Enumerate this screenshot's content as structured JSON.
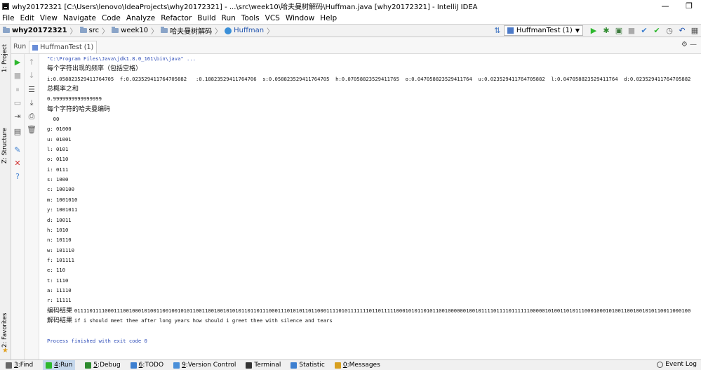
{
  "window": {
    "title": "why20172321 [C:\\Users\\lenovo\\IdeaProjects\\why20172321] - ...\\src\\week10\\哈夫曼树解码\\Huffman.java [why20172321] - IntelliJ IDEA",
    "minimize": "—",
    "maximize": "❐"
  },
  "menu": [
    "File",
    "Edit",
    "View",
    "Navigate",
    "Code",
    "Analyze",
    "Refactor",
    "Build",
    "Run",
    "Tools",
    "VCS",
    "Window",
    "Help"
  ],
  "breadcrumb": [
    "why20172321",
    "src",
    "week10",
    "哈夫曼树解码",
    "Huffman"
  ],
  "run_config": "HuffmanTest (1)",
  "run_panel": {
    "label": "Run",
    "tab": "HuffmanTest (1)"
  },
  "console_lines": [
    {
      "type": "cmd",
      "text": "\"C:\\Program Files\\Java\\jdk1.8.0_161\\bin\\java\" ..."
    },
    {
      "type": "cn",
      "text": "每个字符出现的频率（包括空格）"
    },
    {
      "type": "mono",
      "text": "i:0.058823529411764705  f:0.023529411764705882   :0.18823529411764706  s:0.058823529411764705  h:0.07058823529411765  o:0.047058823529411764  u:0.023529411764705882  l:0.047058823529411764  d:0.023529411764705882"
    },
    {
      "type": "cn",
      "text": "总概率之和"
    },
    {
      "type": "mono",
      "text": "0.9999999999999999"
    },
    {
      "type": "cn",
      "text": "每个字符的哈夫曼编码"
    },
    {
      "type": "mono",
      "text": "  00"
    },
    {
      "type": "mono",
      "text": "g: 01000"
    },
    {
      "type": "mono",
      "text": "u: 01001"
    },
    {
      "type": "mono",
      "text": "l: 0101"
    },
    {
      "type": "mono",
      "text": "o: 0110"
    },
    {
      "type": "mono",
      "text": "i: 0111"
    },
    {
      "type": "mono",
      "text": "s: 1000"
    },
    {
      "type": "mono",
      "text": "c: 100100"
    },
    {
      "type": "mono",
      "text": "m: 1001010"
    },
    {
      "type": "mono",
      "text": "y: 1001011"
    },
    {
      "type": "mono",
      "text": "d: 10011"
    },
    {
      "type": "mono",
      "text": "h: 1010"
    },
    {
      "type": "mono",
      "text": "n: 10110"
    },
    {
      "type": "mono",
      "text": "w: 101110"
    },
    {
      "type": "mono",
      "text": "f: 101111"
    },
    {
      "type": "mono",
      "text": "e: 110"
    },
    {
      "type": "mono",
      "text": "t: 1110"
    },
    {
      "type": "mono",
      "text": "a: 11110"
    },
    {
      "type": "mono",
      "text": "r: 11111"
    },
    {
      "type": "mixed",
      "label": "编码结果 ",
      "text": "01111011110001110010001010011001001010110011001001010101101101110001110101011011000111101011111110110111110001010110101100100000010010111101111011111100000101001101011100010001010011001001010110011000100"
    },
    {
      "type": "mixed",
      "label": "解码结果 ",
      "text": "if i should meet thee after long years how should i greet thee with silence and tears"
    },
    {
      "type": "mono",
      "text": ""
    },
    {
      "type": "exit",
      "text": "Process finished with exit code 0"
    }
  ],
  "left_tabs": {
    "project": "1: Project",
    "structure": "Z: Structure",
    "favorites": "2: Favorites"
  },
  "bottom_tools": [
    {
      "num": "3",
      "label": "Find"
    },
    {
      "num": "4",
      "label": "Run"
    },
    {
      "num": "5",
      "label": "Debug"
    },
    {
      "num": "6",
      "label": "TODO"
    },
    {
      "num": "9",
      "label": "Version Control"
    },
    {
      "num": "",
      "label": "Terminal"
    },
    {
      "num": "",
      "label": "Statistic"
    },
    {
      "num": "0",
      "label": "Messages"
    }
  ],
  "event_log": "Event Log",
  "colors": {
    "run_green": "#2eb82e",
    "console_blue": "#2e4db8",
    "active_tab": "#c6d8ec"
  }
}
